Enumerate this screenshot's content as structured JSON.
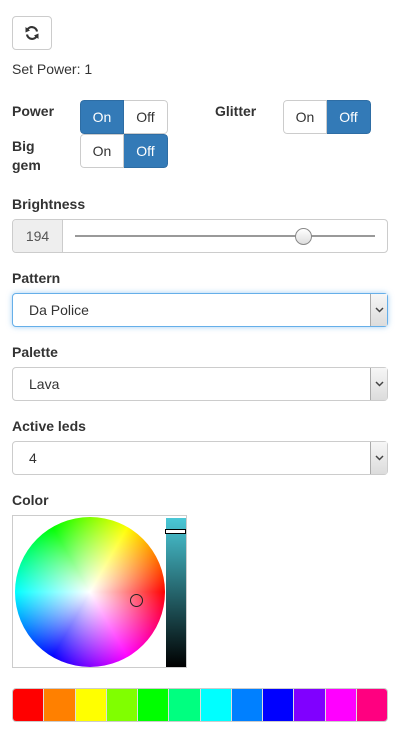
{
  "toolbar": {
    "refresh_icon": "refresh-icon"
  },
  "status": {
    "text": "Set Power: 1"
  },
  "power": {
    "label": "Power",
    "on_label": "On",
    "off_label": "Off",
    "selected": "On"
  },
  "glitter": {
    "label": "Glitter",
    "on_label": "On",
    "off_label": "Off",
    "selected": "Off"
  },
  "big_gem": {
    "label_line1": "Big",
    "label_line2": "gem",
    "on_label": "On",
    "off_label": "Off",
    "selected": "Off"
  },
  "brightness": {
    "label": "Brightness",
    "value": "194",
    "min": 0,
    "max": 255
  },
  "pattern": {
    "label": "Pattern",
    "selected": "Da Police"
  },
  "palette": {
    "label": "Palette",
    "selected": "Lava"
  },
  "active_leds": {
    "label": "Active leds",
    "selected": "4"
  },
  "color": {
    "label": "Color",
    "accent": "#337ab7"
  },
  "swatches": [
    "#ff0000",
    "#ff8000",
    "#ffff00",
    "#80ff00",
    "#00ff00",
    "#00ff80",
    "#00ffff",
    "#0080ff",
    "#0000ff",
    "#8000ff",
    "#ff00ff",
    "#ff0080"
  ]
}
